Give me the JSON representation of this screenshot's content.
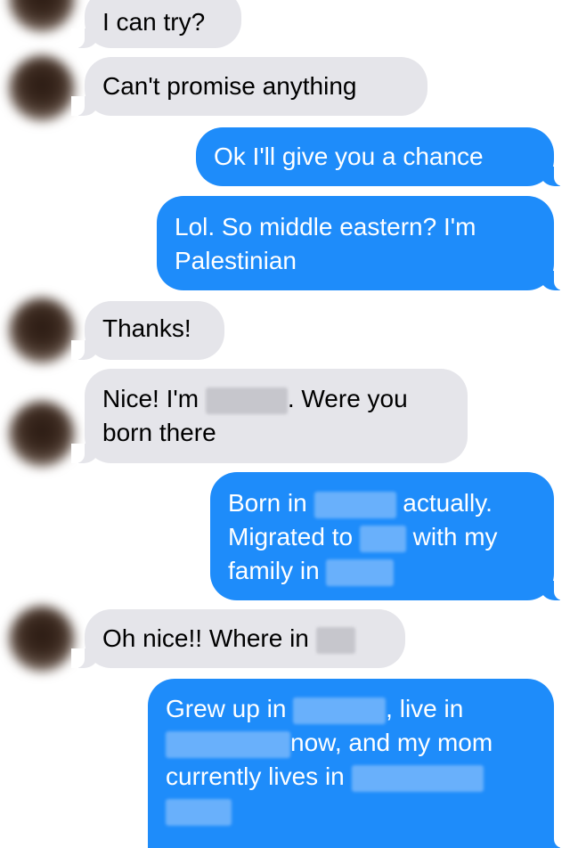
{
  "colors": {
    "incoming_bubble": "#e5e5ea",
    "outgoing_bubble": "#1e8cfa",
    "outgoing_text": "#ffffff",
    "incoming_text": "#000000",
    "background": "#ffffff"
  },
  "messages": [
    {
      "sender": "them",
      "text": "I can try?"
    },
    {
      "sender": "them",
      "text": "Can't promise anything"
    },
    {
      "sender": "me",
      "text": "Ok I'll give you a chance"
    },
    {
      "sender": "me",
      "lines": [
        "Lol. So middle eastern? I'm",
        "Palestinian"
      ]
    },
    {
      "sender": "them",
      "text": "Thanks!"
    },
    {
      "sender": "them",
      "parts": [
        "Nice! I'm ",
        ". Were you",
        "born there"
      ]
    },
    {
      "sender": "me",
      "parts": [
        "Born in ",
        " actually.",
        "Migrated to ",
        " with my",
        "family in "
      ]
    },
    {
      "sender": "them",
      "parts": [
        "Oh nice!! Where in "
      ]
    },
    {
      "sender": "me",
      "parts": [
        "Grew up in ",
        ", live in",
        "now, and my mom",
        "currently lives in "
      ]
    }
  ]
}
